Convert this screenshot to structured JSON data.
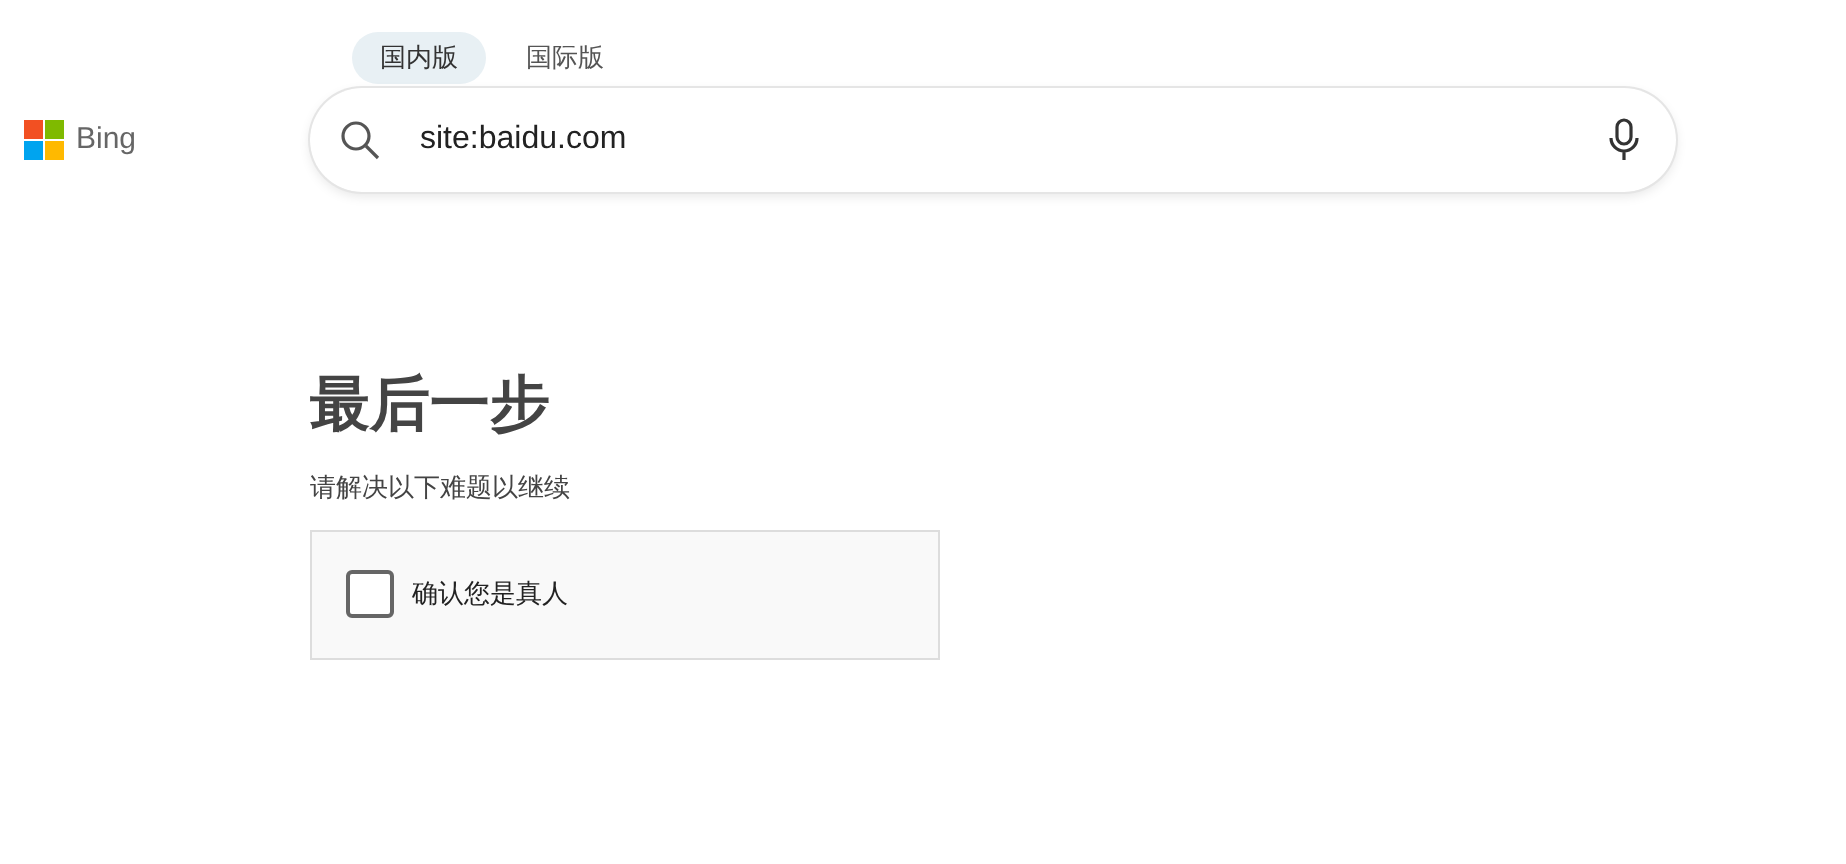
{
  "logo": {
    "text": "Bing"
  },
  "tabs": [
    {
      "label": "国内版",
      "selected": true
    },
    {
      "label": "国际版",
      "selected": false
    }
  ],
  "search": {
    "value": "site:baidu.com"
  },
  "challenge": {
    "title": "最后一步",
    "subtitle": "请解决以下难题以继续",
    "checkbox": {
      "label": "确认您是真人",
      "checked": false
    }
  }
}
